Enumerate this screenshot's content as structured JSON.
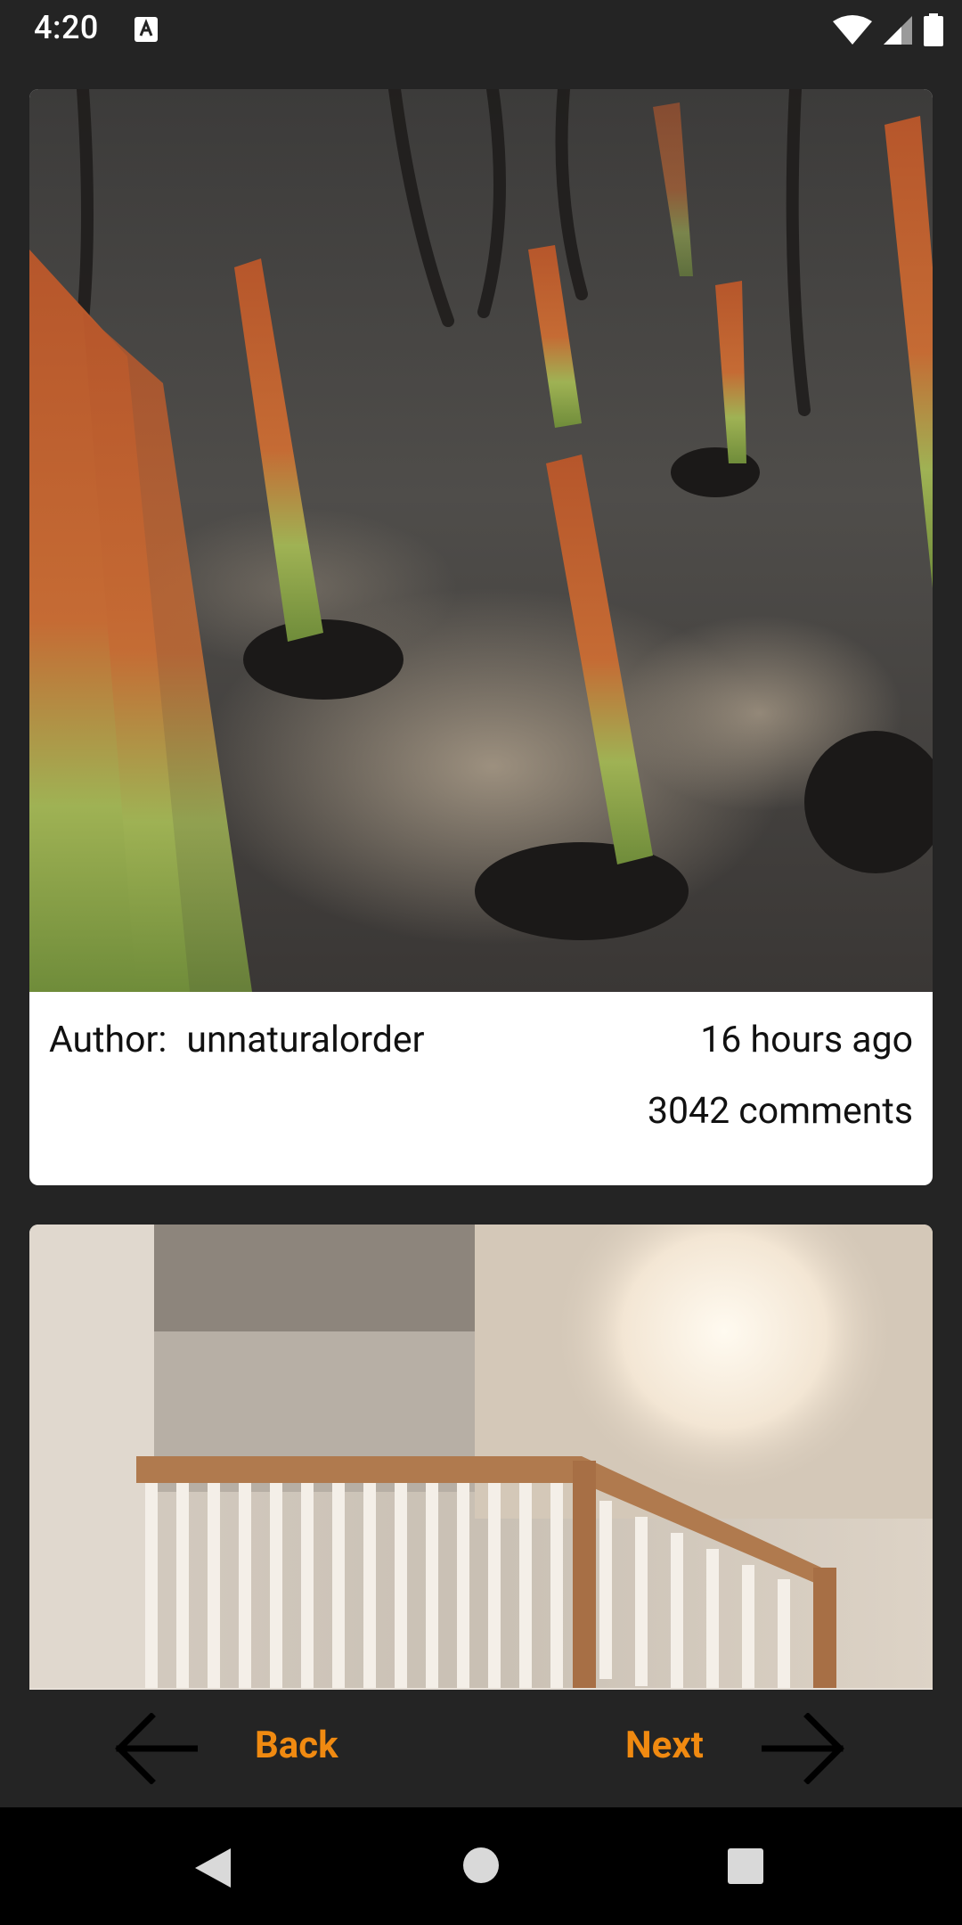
{
  "status_bar": {
    "time": "4:20",
    "icons": [
      "text-input-indicator-icon",
      "wifi-icon",
      "signal-icon",
      "battery-icon"
    ]
  },
  "posts": [
    {
      "image_alt": "Burnt ground with green-orange grass-tree shoots regrowing",
      "author_label": "Author:",
      "author": "unnaturalorder",
      "time_ago": "16 hours ago",
      "comments": "3042 comments"
    },
    {
      "image_alt": "Interior staircase with white railing and bright chandelier"
    }
  ],
  "nav": {
    "back_label": "Back",
    "next_label": "Next"
  },
  "colors": {
    "background": "#242424",
    "accent": "#f08a11",
    "card": "#ffffff",
    "system_nav": "#000000"
  }
}
